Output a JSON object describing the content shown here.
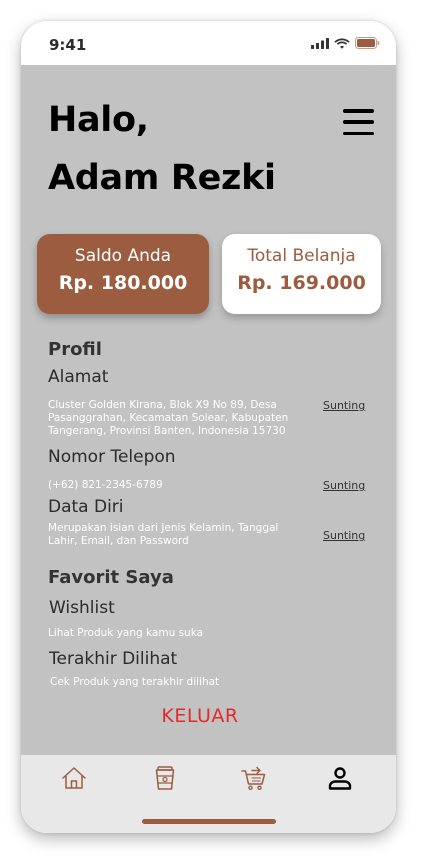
{
  "status": {
    "time": "9:41"
  },
  "header": {
    "greeting": "Halo,",
    "name": "Adam Rezki"
  },
  "cards": {
    "saldo": {
      "label": "Saldo Anda",
      "amount": "Rp. 180.000"
    },
    "total": {
      "label": "Total Belanja",
      "amount": "Rp. 169.000"
    }
  },
  "profil": {
    "title": "Profil",
    "alamat": {
      "label": "Alamat",
      "lines": [
        "Cluster Golden Kirana, Blok X9 No 89, Desa",
        "Pasanggrahan, Kecamatan Solear, Kabupaten",
        "Tangerang, Provinsi Banten, Indonesia 15730"
      ],
      "edit": "Sunting"
    },
    "telepon": {
      "label": "Nomor Telepon",
      "value": "(+62) 821-2345-6789",
      "edit": "Sunting"
    },
    "data_diri": {
      "label": "Data Diri",
      "lines": [
        "Merupakan isian dari Jenis Kelamin, Tanggal",
        "Lahir, Email, dan Password"
      ],
      "edit": "Sunting"
    }
  },
  "favorit": {
    "title": "Favorit Saya",
    "wishlist": {
      "label": "Wishlist",
      "desc": "Lihat Produk yang kamu suka"
    },
    "terakhir": {
      "label": "Terakhir Dilihat",
      "desc": "Cek Produk yang terakhir dilihat"
    }
  },
  "logout_label": "KELUAR",
  "nav": {
    "items": [
      {
        "icon": "home-icon",
        "active": false
      },
      {
        "icon": "cup-icon",
        "active": false
      },
      {
        "icon": "cart-icon",
        "active": false
      },
      {
        "icon": "profile-icon",
        "active": true
      }
    ]
  },
  "colors": {
    "brand": "#9b5c3f",
    "background": "#c2c2c2",
    "logout": "#e12b2b",
    "navbar": "#e8e8e8"
  }
}
